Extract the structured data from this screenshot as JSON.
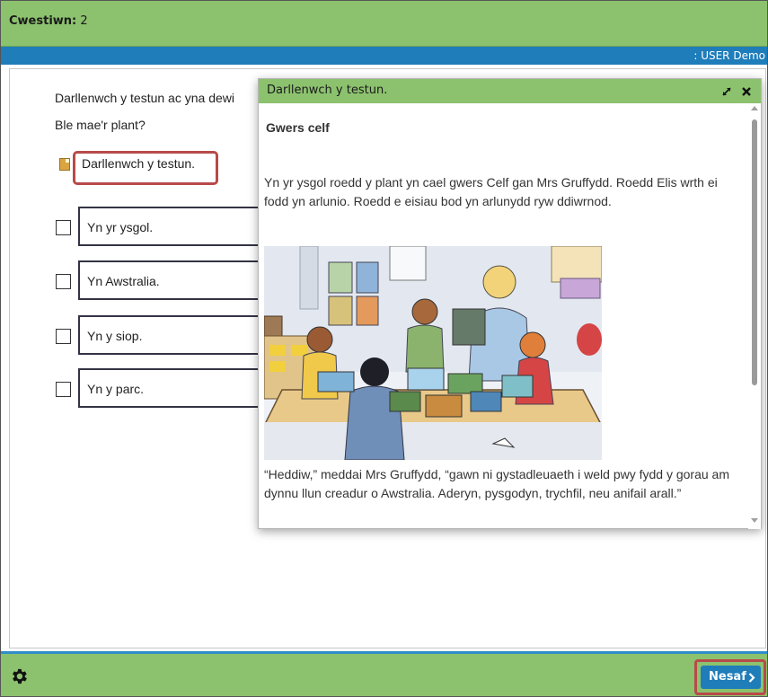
{
  "header": {
    "question_label": "Cwestiwn:",
    "question_number": "2",
    "user_text": ": USER Demo"
  },
  "main": {
    "instruction": "Darllenwch y testun ac yna dewi",
    "question": "Ble mae'r plant?",
    "read_link": "Darllenwch y testun.",
    "options": [
      {
        "label": "Yn yr ysgol."
      },
      {
        "label": "Yn Awstralia."
      },
      {
        "label": "Yn y siop."
      },
      {
        "label": "Yn y parc."
      }
    ]
  },
  "popup": {
    "title": "Darllenwch y testun.",
    "story_title": "Gwers celf",
    "paragraph1": "Yn yr ysgol roedd y plant yn cael gwers Celf gan Mrs Gruffydd. Roedd Elis wrth ei fodd yn arlunio. Roedd e eisiau bod yn arlunydd ryw ddiwrnod.",
    "paragraph2": "“Heddiw,” meddai Mrs Gruffydd, “gawn ni gystadleuaeth i weld pwy fydd y gorau am dynnu llun creadur o Awstralia. Aderyn, pysgodyn, trychfil, neu anifail arall.”"
  },
  "footer": {
    "next_label": "Nesaf"
  },
  "colors": {
    "green_bar": "#8cc26e",
    "blue_bar": "#1f7dba",
    "highlight_red": "#b84a4a"
  },
  "icons": [
    "gear-icon",
    "expand-icon",
    "close-icon",
    "chevron-right-icon",
    "document-icon"
  ]
}
